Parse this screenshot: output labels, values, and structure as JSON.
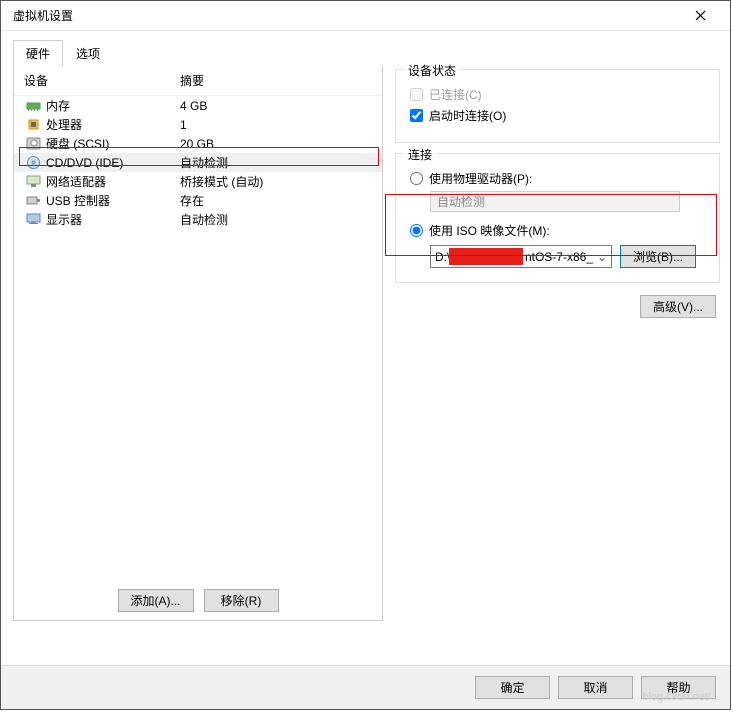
{
  "window": {
    "title": "虚拟机设置"
  },
  "tabs": {
    "hardware": "硬件",
    "options": "选项"
  },
  "columns": {
    "device": "设备",
    "summary": "摘要"
  },
  "hardware": [
    {
      "icon": "memory",
      "name": "内存",
      "summary": "4 GB"
    },
    {
      "icon": "cpu",
      "name": "处理器",
      "summary": "1"
    },
    {
      "icon": "disk",
      "name": "硬盘 (SCSI)",
      "summary": "20 GB"
    },
    {
      "icon": "cd",
      "name": "CD/DVD (IDE)",
      "summary": "自动检测",
      "selected": true
    },
    {
      "icon": "net",
      "name": "网络适配器",
      "summary": "桥接模式 (自动)"
    },
    {
      "icon": "usb",
      "name": "USB 控制器",
      "summary": "存在"
    },
    {
      "icon": "display",
      "name": "显示器",
      "summary": "自动检测"
    }
  ],
  "buttons": {
    "add": "添加(A)...",
    "remove": "移除(R)",
    "browse": "浏览(B)...",
    "advanced": "高级(V)...",
    "ok": "确定",
    "cancel": "取消",
    "help": "帮助"
  },
  "device_status": {
    "legend": "设备状态",
    "connected": "已连接(C)",
    "connect_at_power_on": "启动时连接(O)",
    "connected_checked": false,
    "connect_at_power_on_checked": true
  },
  "connection": {
    "legend": "连接",
    "use_physical": "使用物理驱动器(P):",
    "auto_detect": "自动检测",
    "use_iso": "使用 ISO 映像文件(M):",
    "iso_prefix": "D:\\",
    "iso_suffix": "ntOS-7-x86_",
    "selected": "iso"
  },
  "watermark": "blog.csdn.net/..."
}
